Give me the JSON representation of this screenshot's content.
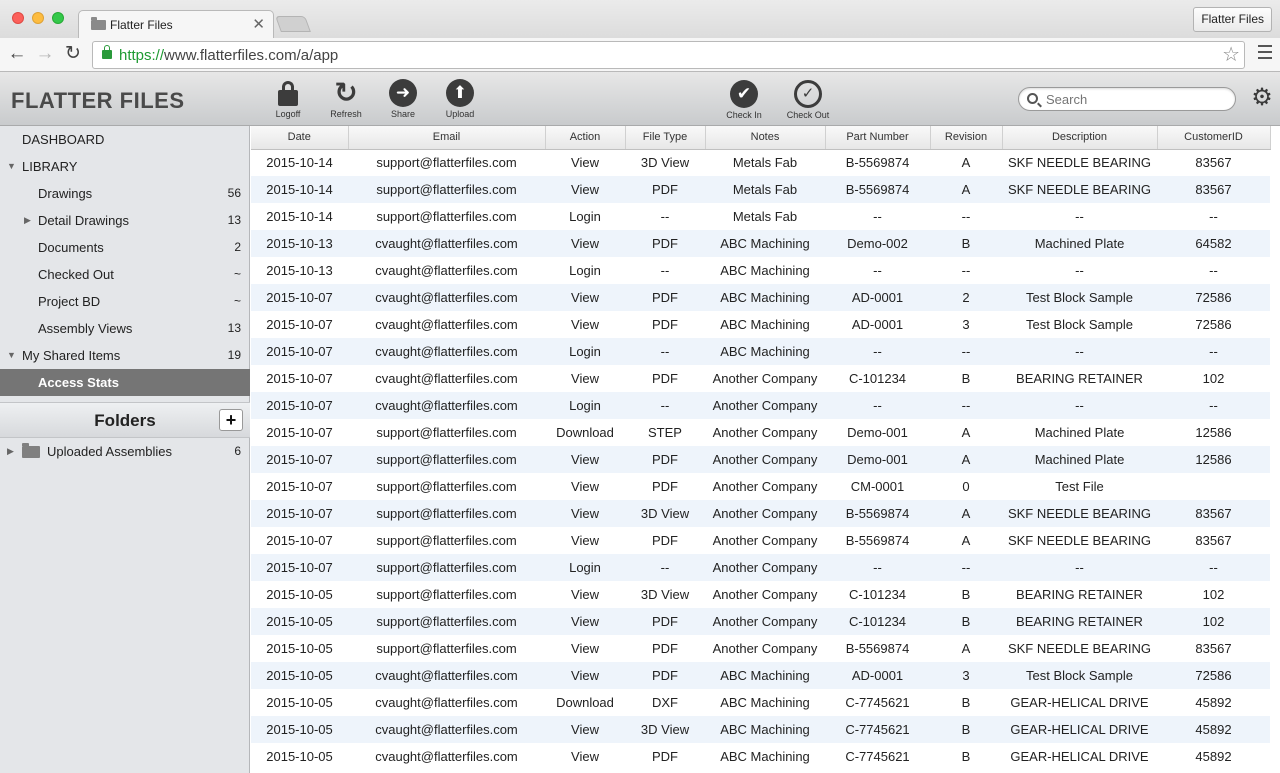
{
  "browser": {
    "tab_title": "Flatter Files",
    "profile": "Flatter Files",
    "url_scheme": "https://",
    "url_rest": "www.flatterfiles.com/a/app"
  },
  "brand": "FLATTER FILES",
  "toolbar": {
    "logoff": "Logoff",
    "refresh": "Refresh",
    "share": "Share",
    "upload": "Upload",
    "checkin": "Check In",
    "checkout": "Check Out",
    "search_placeholder": "Search"
  },
  "sidebar": {
    "dashboard": "DASHBOARD",
    "library": "LIBRARY",
    "items": [
      {
        "label": "Drawings",
        "count": "56"
      },
      {
        "label": "Detail Drawings",
        "count": "13"
      },
      {
        "label": "Documents",
        "count": "2"
      },
      {
        "label": "Checked Out",
        "count": "~"
      },
      {
        "label": "Project BD",
        "count": "~"
      },
      {
        "label": "Assembly Views",
        "count": "13"
      }
    ],
    "shared": {
      "label": "My Shared Items",
      "count": "19"
    },
    "access_stats": "Access Stats",
    "folders_title": "Folders",
    "add_folder": "+",
    "folder": {
      "label": "Uploaded Assemblies",
      "count": "6"
    }
  },
  "table": {
    "columns": [
      "Date",
      "Email",
      "Action",
      "File Type",
      "Notes",
      "Part Number",
      "Revision",
      "Description",
      "CustomerID"
    ],
    "rows": [
      [
        "2015-10-14",
        "support@flatterfiles.com",
        "View",
        "3D View",
        "Metals Fab",
        "B-5569874",
        "A",
        "SKF NEEDLE BEARING",
        "83567"
      ],
      [
        "2015-10-14",
        "support@flatterfiles.com",
        "View",
        "PDF",
        "Metals Fab",
        "B-5569874",
        "A",
        "SKF NEEDLE BEARING",
        "83567"
      ],
      [
        "2015-10-14",
        "support@flatterfiles.com",
        "Login",
        "--",
        "Metals Fab",
        "--",
        "--",
        "--",
        "--"
      ],
      [
        "2015-10-13",
        "cvaught@flatterfiles.com",
        "View",
        "PDF",
        "ABC Machining",
        "Demo-002",
        "B",
        "Machined Plate",
        "64582"
      ],
      [
        "2015-10-13",
        "cvaught@flatterfiles.com",
        "Login",
        "--",
        "ABC Machining",
        "--",
        "--",
        "--",
        "--"
      ],
      [
        "2015-10-07",
        "cvaught@flatterfiles.com",
        "View",
        "PDF",
        "ABC Machining",
        "AD-0001",
        "2",
        "Test Block Sample",
        "72586"
      ],
      [
        "2015-10-07",
        "cvaught@flatterfiles.com",
        "View",
        "PDF",
        "ABC Machining",
        "AD-0001",
        "3",
        "Test Block Sample",
        "72586"
      ],
      [
        "2015-10-07",
        "cvaught@flatterfiles.com",
        "Login",
        "--",
        "ABC Machining",
        "--",
        "--",
        "--",
        "--"
      ],
      [
        "2015-10-07",
        "cvaught@flatterfiles.com",
        "View",
        "PDF",
        "Another Company",
        "C-101234",
        "B",
        "BEARING RETAINER",
        "102"
      ],
      [
        "2015-10-07",
        "cvaught@flatterfiles.com",
        "Login",
        "--",
        "Another Company",
        "--",
        "--",
        "--",
        "--"
      ],
      [
        "2015-10-07",
        "support@flatterfiles.com",
        "Download",
        "STEP",
        "Another Company",
        "Demo-001",
        "A",
        "Machined Plate",
        "12586"
      ],
      [
        "2015-10-07",
        "support@flatterfiles.com",
        "View",
        "PDF",
        "Another Company",
        "Demo-001",
        "A",
        "Machined Plate",
        "12586"
      ],
      [
        "2015-10-07",
        "support@flatterfiles.com",
        "View",
        "PDF",
        "Another Company",
        "CM-0001",
        "0",
        "Test File",
        ""
      ],
      [
        "2015-10-07",
        "support@flatterfiles.com",
        "View",
        "3D View",
        "Another Company",
        "B-5569874",
        "A",
        "SKF NEEDLE BEARING",
        "83567"
      ],
      [
        "2015-10-07",
        "support@flatterfiles.com",
        "View",
        "PDF",
        "Another Company",
        "B-5569874",
        "A",
        "SKF NEEDLE BEARING",
        "83567"
      ],
      [
        "2015-10-07",
        "support@flatterfiles.com",
        "Login",
        "--",
        "Another Company",
        "--",
        "--",
        "--",
        "--"
      ],
      [
        "2015-10-05",
        "support@flatterfiles.com",
        "View",
        "3D View",
        "Another Company",
        "C-101234",
        "B",
        "BEARING RETAINER",
        "102"
      ],
      [
        "2015-10-05",
        "support@flatterfiles.com",
        "View",
        "PDF",
        "Another Company",
        "C-101234",
        "B",
        "BEARING RETAINER",
        "102"
      ],
      [
        "2015-10-05",
        "support@flatterfiles.com",
        "View",
        "PDF",
        "Another Company",
        "B-5569874",
        "A",
        "SKF NEEDLE BEARING",
        "83567"
      ],
      [
        "2015-10-05",
        "cvaught@flatterfiles.com",
        "View",
        "PDF",
        "ABC Machining",
        "AD-0001",
        "3",
        "Test Block Sample",
        "72586"
      ],
      [
        "2015-10-05",
        "cvaught@flatterfiles.com",
        "Download",
        "DXF",
        "ABC Machining",
        "C-7745621",
        "B",
        "GEAR-HELICAL DRIVE",
        "45892"
      ],
      [
        "2015-10-05",
        "cvaught@flatterfiles.com",
        "View",
        "3D View",
        "ABC Machining",
        "C-7745621",
        "B",
        "GEAR-HELICAL DRIVE",
        "45892"
      ],
      [
        "2015-10-05",
        "cvaught@flatterfiles.com",
        "View",
        "PDF",
        "ABC Machining",
        "C-7745621",
        "B",
        "GEAR-HELICAL DRIVE",
        "45892"
      ]
    ]
  },
  "icons": {
    "folder": "folder-icon",
    "lock": "lock-icon",
    "refresh": "refresh-icon",
    "share": "share-arrow-icon",
    "upload": "upload-arrow-icon",
    "checkin": "check-circle-icon",
    "checkout": "check-ring-icon",
    "search": "search-icon",
    "gear": "gear-icon"
  }
}
